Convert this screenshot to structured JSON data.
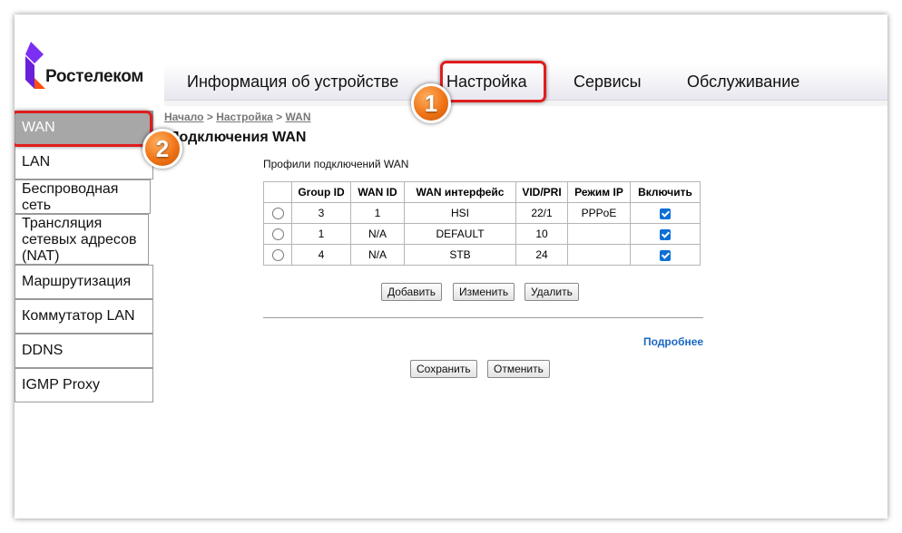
{
  "brand": {
    "logo_text": "Ростелеком",
    "colors": {
      "purple": "#7b2ff2",
      "orange": "#ff4f12"
    }
  },
  "topnav": [
    {
      "label": "Информация об устройстве"
    },
    {
      "label": "Настройка"
    },
    {
      "label": "Сервисы"
    },
    {
      "label": "Обслуживание"
    }
  ],
  "sidebar": [
    {
      "label": "WAN"
    },
    {
      "label": "LAN"
    },
    {
      "label": "Беспроводная сеть"
    },
    {
      "label": "Трансляция сетевых адресов (NAT)"
    },
    {
      "label": "Маршрутизация"
    },
    {
      "label": "Коммутатор LAN"
    },
    {
      "label": "DDNS"
    },
    {
      "label": "IGMP Proxy"
    }
  ],
  "breadcrumb": {
    "home": "Начало",
    "sep": ">",
    "section": "Настройка",
    "page": "WAN"
  },
  "page_title": "Подключения WAN",
  "section_label": "Профили подключений WAN",
  "table": {
    "headers": [
      "",
      "Group ID",
      "WAN ID",
      "WAN интерфейс",
      "VID/PRI",
      "Режим IP",
      "Включить"
    ],
    "rows": [
      {
        "group_id": "3",
        "wan_id": "1",
        "interface": "HSI",
        "vid_pri": "22/1",
        "ip_mode": "PPPoE",
        "enabled": true
      },
      {
        "group_id": "1",
        "wan_id": "N/A",
        "interface": "DEFAULT",
        "vid_pri": "10",
        "ip_mode": "",
        "enabled": true
      },
      {
        "group_id": "4",
        "wan_id": "N/A",
        "interface": "STB",
        "vid_pri": "24",
        "ip_mode": "",
        "enabled": true
      }
    ]
  },
  "buttons": {
    "add": "Добавить",
    "edit": "Изменить",
    "delete": "Удалить",
    "save": "Сохранить",
    "cancel": "Отменить"
  },
  "more_link": "Подробнее",
  "annotations": {
    "badge1": "1",
    "badge2": "2",
    "highlight_color": "#e01d1d",
    "badge_color": "#f07417"
  }
}
